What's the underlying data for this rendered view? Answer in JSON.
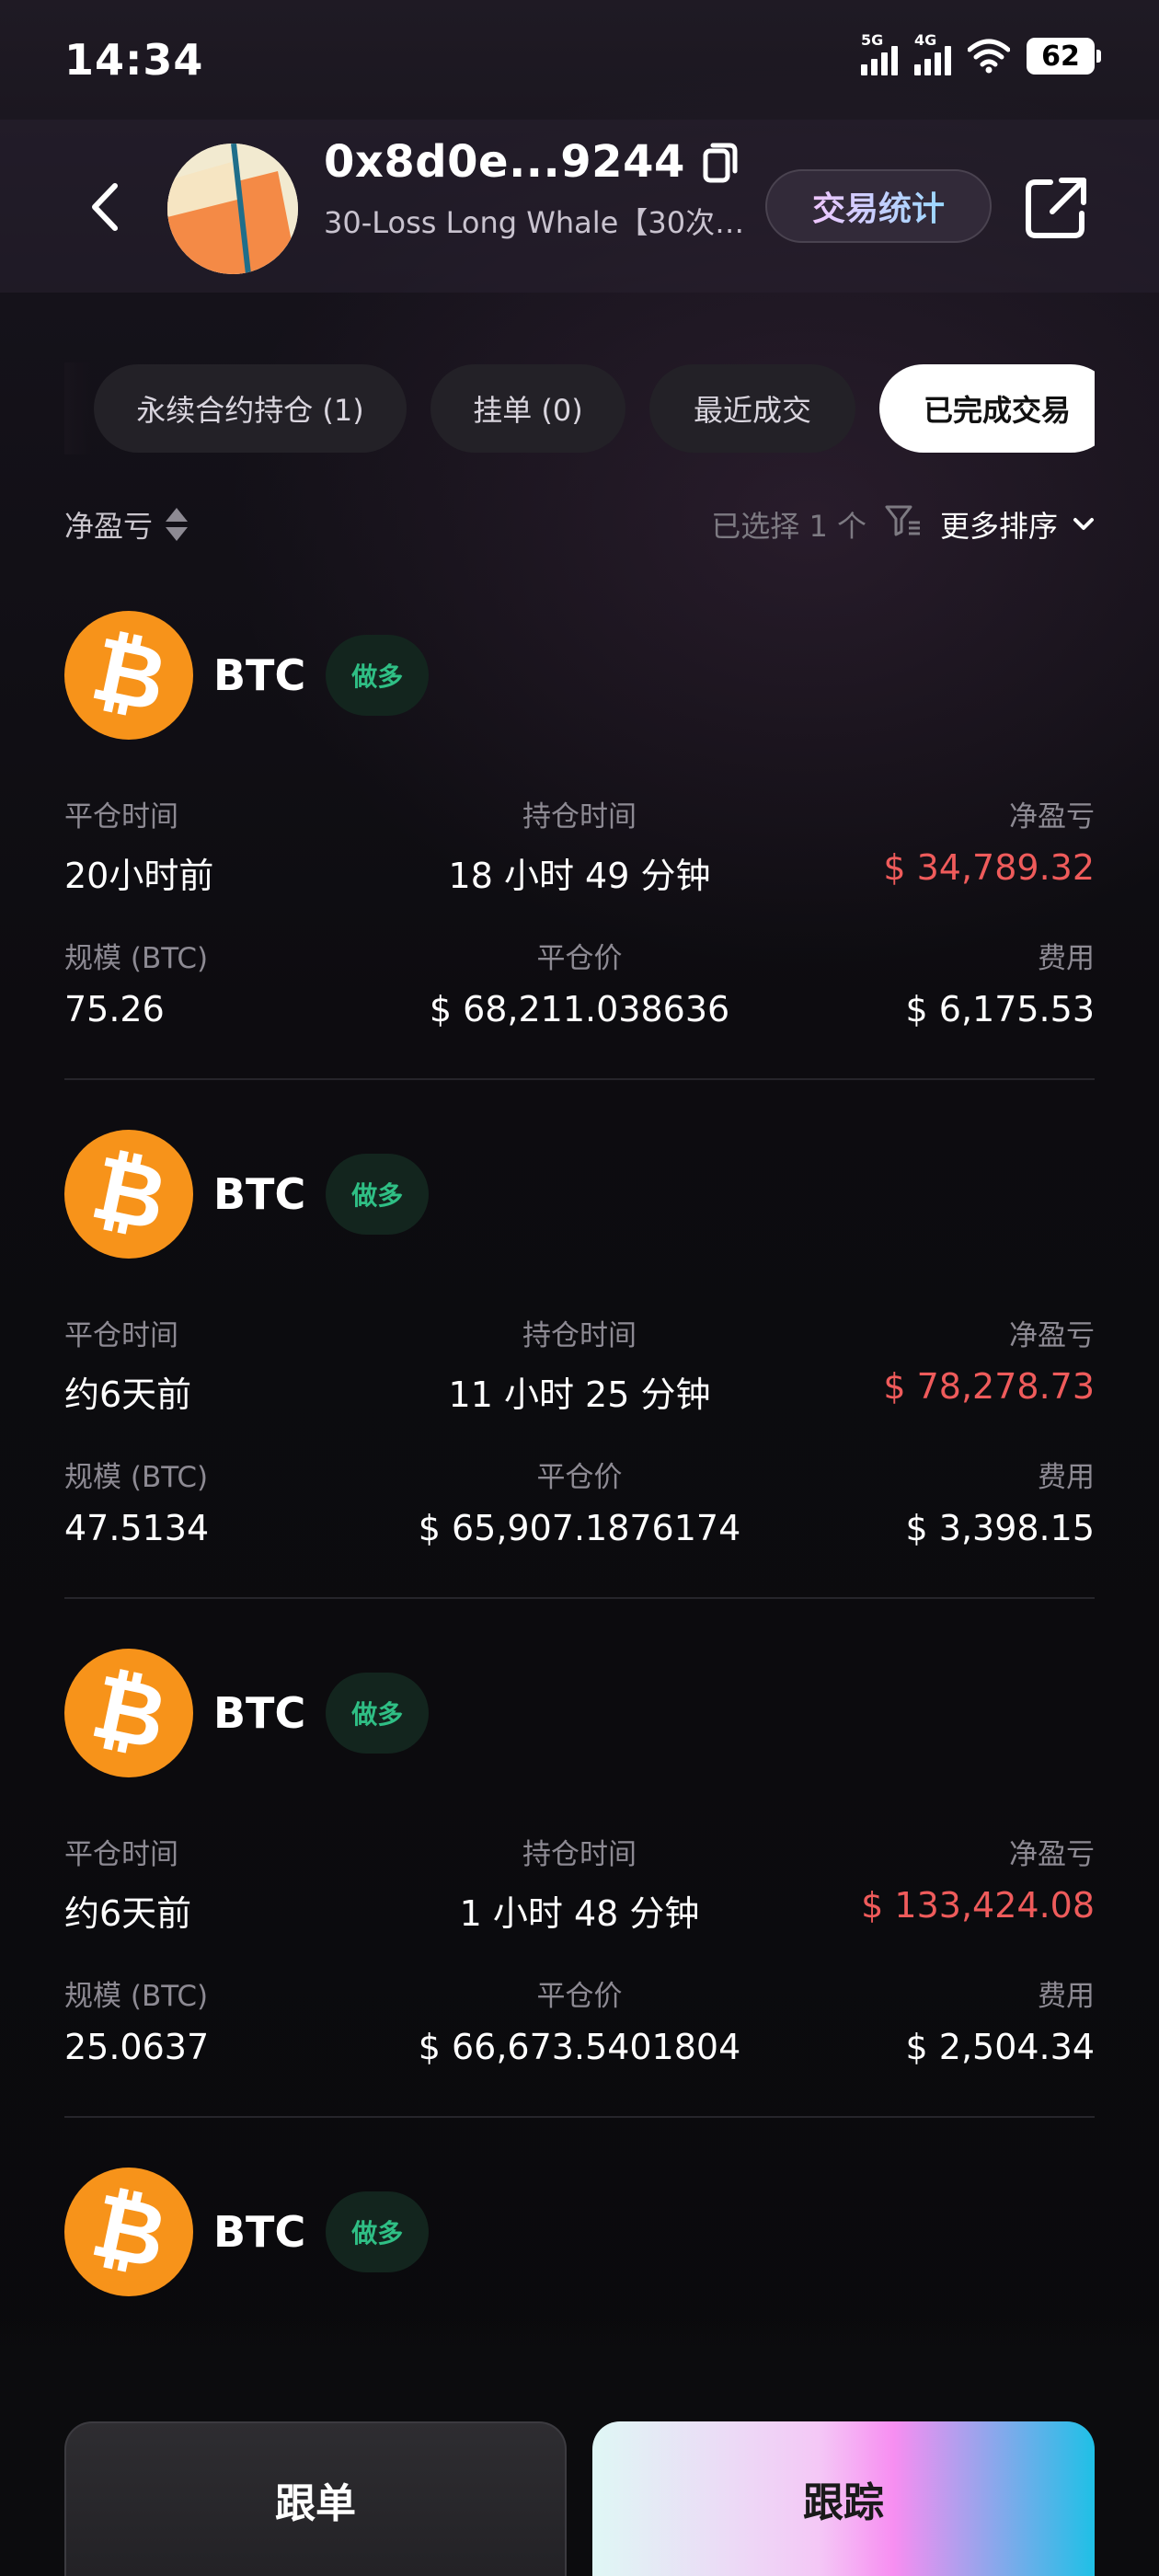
{
  "status_bar": {
    "time": "14:34",
    "signal1_label": "5G",
    "signal2_label": "4G",
    "battery": "62"
  },
  "header": {
    "address": "0x8d0e...9244",
    "subtitle": "30-Loss Long Whale【30次…",
    "stats_button": "交易统计"
  },
  "tabs": [
    {
      "label": "永续合约持仓 (1)",
      "active": false
    },
    {
      "label": "挂单 (0)",
      "active": false
    },
    {
      "label": "最近成交",
      "active": false
    },
    {
      "label": "已完成交易",
      "active": true
    }
  ],
  "sort": {
    "left_label": "净盈亏",
    "selected_text": "已选择 1 个",
    "more_sort": "更多排序"
  },
  "labels": {
    "close_time": "平仓时间",
    "hold_time": "持仓时间",
    "net_pnl": "净盈亏",
    "size": "规模 (BTC)",
    "close_price": "平仓价",
    "fee": "费用"
  },
  "trades": [
    {
      "coin": "BTC",
      "side": "做多",
      "close_time": "20小时前",
      "hold_time": "18 小时 49 分钟",
      "pnl": "$ 34,789.32",
      "size": "75.26",
      "close_price": "$ 68,211.038636",
      "fee": "$ 6,175.53"
    },
    {
      "coin": "BTC",
      "side": "做多",
      "close_time": "约6天前",
      "hold_time": "11 小时 25 分钟",
      "pnl": "$ 78,278.73",
      "size": "47.5134",
      "close_price": "$ 65,907.1876174",
      "fee": "$ 3,398.15"
    },
    {
      "coin": "BTC",
      "side": "做多",
      "close_time": "约6天前",
      "hold_time": "1 小时 48 分钟",
      "pnl": "$ 133,424.08",
      "size": "25.0637",
      "close_price": "$ 66,673.5401804",
      "fee": "$ 2,504.34"
    },
    {
      "coin": "BTC",
      "side": "做多"
    }
  ],
  "bottom": {
    "copy_button": "跟单",
    "track_button": "跟踪"
  },
  "colors": {
    "loss": "#ef5b5b",
    "long_badge": "#2fbf85",
    "btc_orange": "#f7931a"
  },
  "icons": [
    "back-arrow-icon",
    "copy-icon",
    "share-external-icon",
    "sort-arrows-icon",
    "filter-icon",
    "chevron-down-icon",
    "bitcoin-icon"
  ]
}
